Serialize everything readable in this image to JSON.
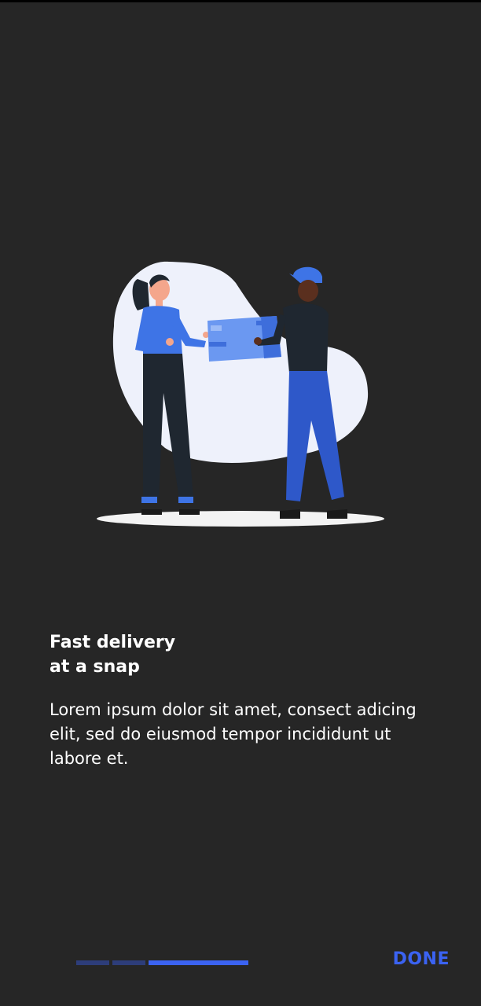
{
  "onboarding": {
    "title_line1": "Fast delivery",
    "title_line2": "at a snap",
    "description": "Lorem ipsum dolor sit amet, consect adicing elit, sed do eiusmod tempor incididunt ut labore et."
  },
  "pager": {
    "total": 3,
    "active_index": 2
  },
  "actions": {
    "done_label": "DONE"
  },
  "colors": {
    "background": "#262626",
    "accent": "#3b63f2",
    "pager_inactive": "#2d3d7a",
    "text": "#ffffff"
  },
  "illustration": {
    "icon": "delivery-handoff-illustration"
  }
}
